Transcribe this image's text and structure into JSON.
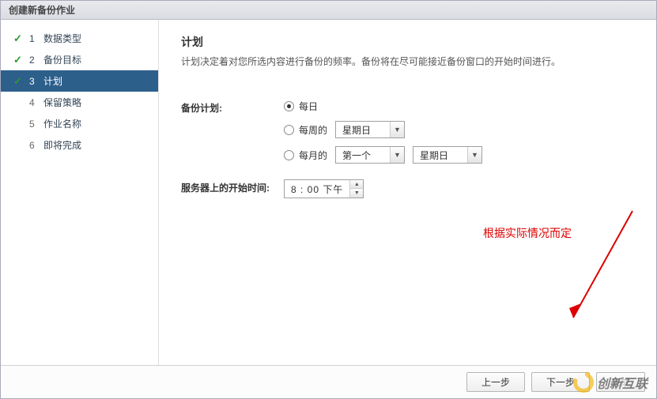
{
  "title": "创建新备份作业",
  "steps": [
    {
      "num": "1",
      "label": "数据类型",
      "done": true
    },
    {
      "num": "2",
      "label": "备份目标",
      "done": true
    },
    {
      "num": "3",
      "label": "计划",
      "active": true
    },
    {
      "num": "4",
      "label": "保留策略"
    },
    {
      "num": "5",
      "label": "作业名称"
    },
    {
      "num": "6",
      "label": "即将完成"
    }
  ],
  "main": {
    "heading": "计划",
    "desc": "计划决定着对您所选内容进行备份的频率。备份将在尽可能接近备份窗口的开始时间进行。"
  },
  "form": {
    "schedule_label": "备份计划:",
    "opt_daily": "每日",
    "opt_weekly": "每周的",
    "opt_monthly": "每月的",
    "weekday": "星期日",
    "month_pos": "第一个",
    "month_weekday": "星期日",
    "time_label": "服务器上的开始时间:",
    "time_value": "8 : 00 下午"
  },
  "note": "根据实际情况而定",
  "footer": {
    "prev": "上一步",
    "next": "下一步",
    "finish": "完成"
  },
  "watermark": "创新互联"
}
